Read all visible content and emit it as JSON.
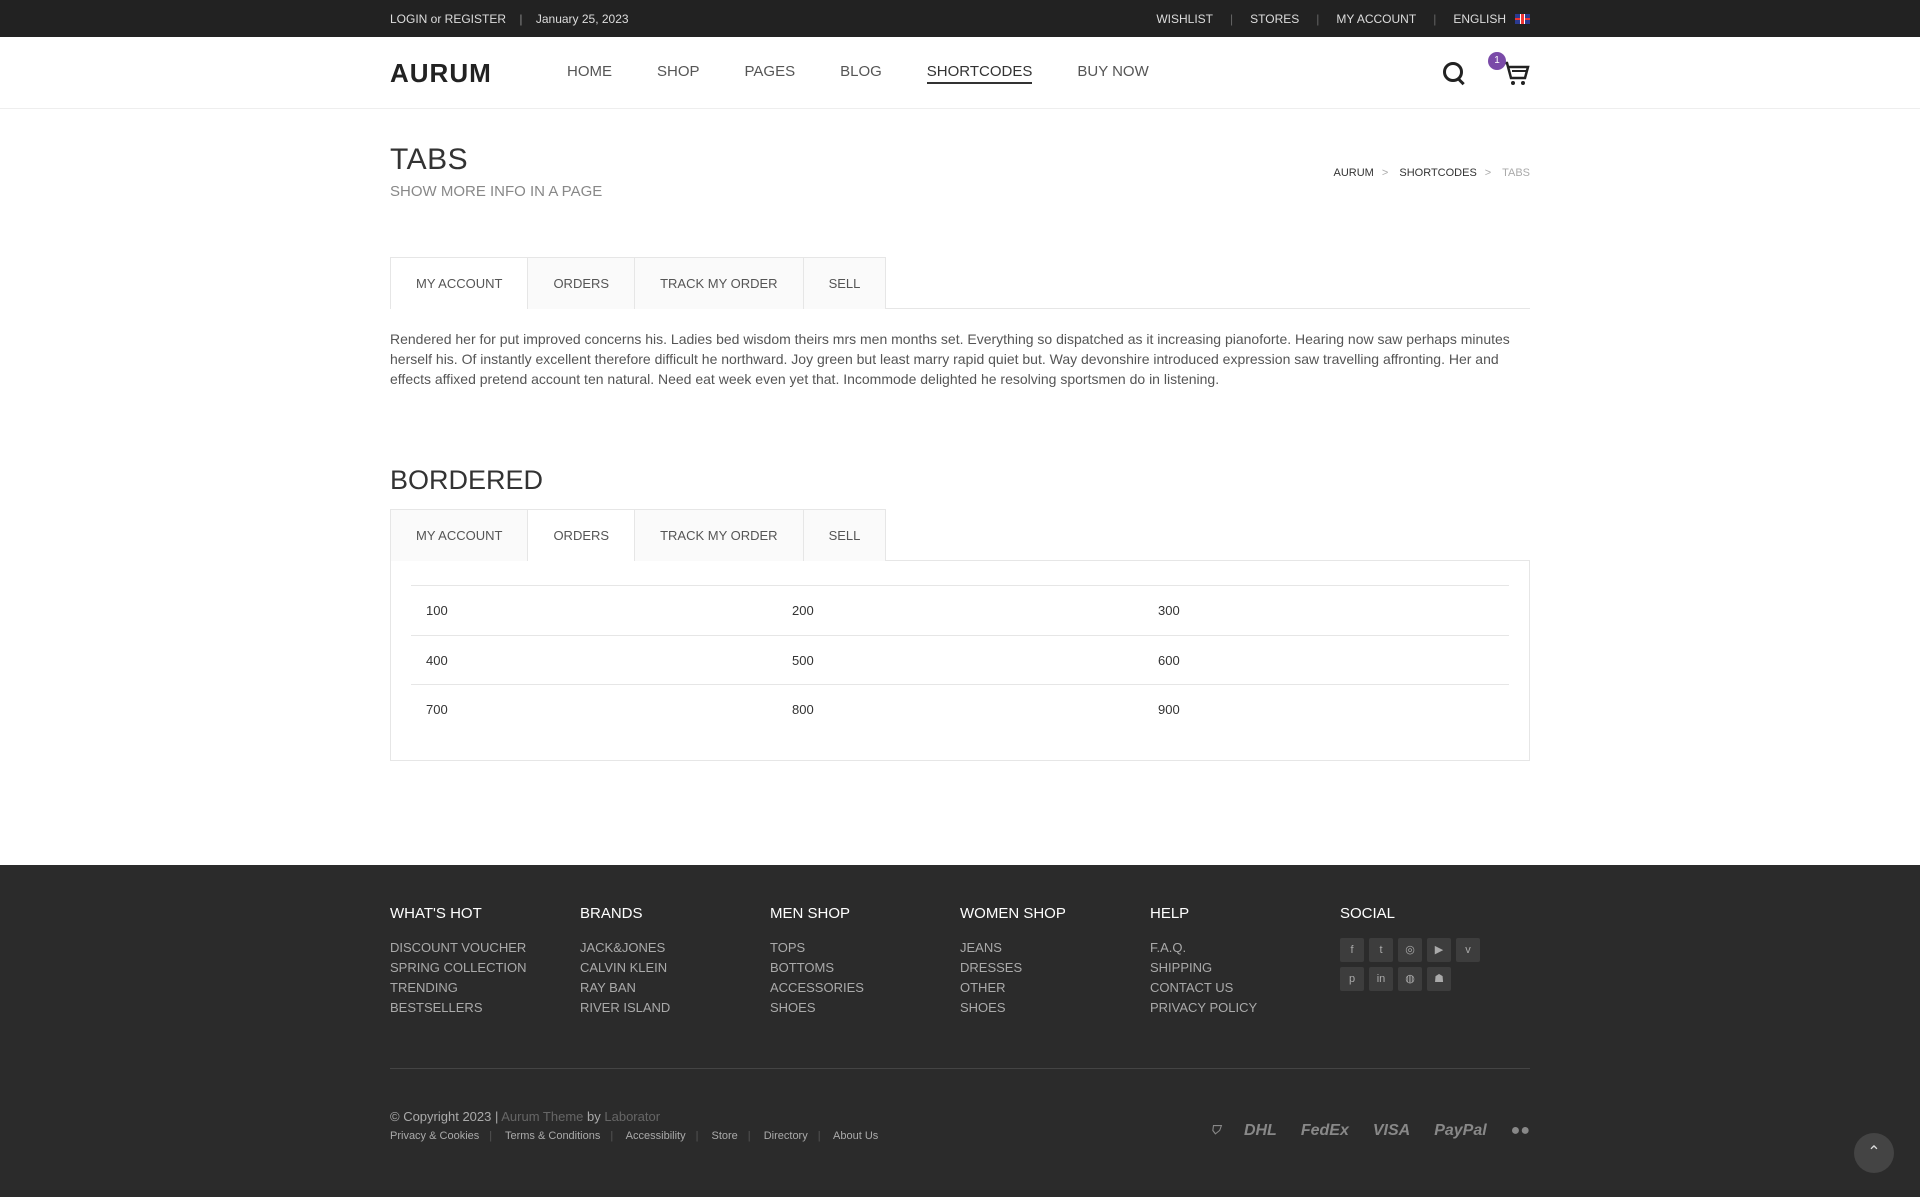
{
  "topbar": {
    "login": "LOGIN or REGISTER",
    "date": "January 25, 2023",
    "links": [
      "WISHLIST",
      "STORES",
      "MY ACCOUNT",
      "ENGLISH"
    ]
  },
  "header": {
    "logo": "AURUM",
    "nav": [
      "HOME",
      "SHOP",
      "PAGES",
      "BLOG",
      "SHORTCODES",
      "BUY NOW"
    ],
    "active_nav": "SHORTCODES",
    "cart_count": "1"
  },
  "page": {
    "title": "TABS",
    "subtitle": "SHOW MORE INFO IN A PAGE",
    "breadcrumb": [
      "AURUM",
      "SHORTCODES",
      "TABS"
    ]
  },
  "tabs1": {
    "items": [
      "MY ACCOUNT",
      "ORDERS",
      "TRACK MY ORDER",
      "SELL"
    ],
    "active": "MY ACCOUNT",
    "content": "Rendered her for put improved concerns his. Ladies bed wisdom theirs mrs men months set. Everything so dispatched as it increasing pianoforte. Hearing now saw perhaps minutes herself his. Of instantly excellent therefore difficult he northward. Joy green but least marry rapid quiet but. Way devonshire introduced expression saw travelling affronting. Her and effects affixed pretend account ten natural. Need eat week even yet that. Incommode delighted he resolving sportsmen do in listening."
  },
  "tabs2": {
    "heading": "BORDERED",
    "items": [
      "MY ACCOUNT",
      "ORDERS",
      "TRACK MY ORDER",
      "SELL"
    ],
    "active": "ORDERS",
    "rows": [
      [
        "100",
        "200",
        "300"
      ],
      [
        "400",
        "500",
        "600"
      ],
      [
        "700",
        "800",
        "900"
      ]
    ]
  },
  "footer": {
    "columns": [
      {
        "title": "WHAT'S HOT",
        "items": [
          "DISCOUNT VOUCHER",
          "SPRING COLLECTION",
          "TRENDING",
          "BESTSELLERS"
        ]
      },
      {
        "title": "BRANDS",
        "items": [
          "JACK&JONES",
          "CALVIN KLEIN",
          "RAY BAN",
          "RIVER ISLAND"
        ]
      },
      {
        "title": "MEN SHOP",
        "items": [
          "TOPS",
          "BOTTOMS",
          "ACCESSORIES",
          "SHOES"
        ]
      },
      {
        "title": "WOMEN SHOP",
        "items": [
          "JEANS",
          "DRESSES",
          "OTHER",
          "SHOES"
        ]
      },
      {
        "title": "HELP",
        "items": [
          "F.A.Q.",
          "SHIPPING",
          "CONTACT US",
          "PRIVACY POLICY"
        ]
      }
    ],
    "social_title": "SOCIAL",
    "social_icons": [
      "facebook-icon",
      "twitter-icon",
      "instagram-icon",
      "youtube-icon",
      "vimeo-icon",
      "pinterest-icon",
      "linkedin-icon",
      "dribbble-icon",
      "snapchat-icon"
    ],
    "copyright": "© Copyright 2023 |",
    "theme": "Aurum Theme",
    "by": "by",
    "author": "Laborator",
    "links": [
      "Privacy & Cookies",
      "Terms & Conditions",
      "Accessibility",
      "Store",
      "Directory",
      "About Us"
    ],
    "payments": [
      "ups",
      "DHL",
      "FedEx",
      "VISA",
      "PayPal",
      "mastercard"
    ]
  }
}
